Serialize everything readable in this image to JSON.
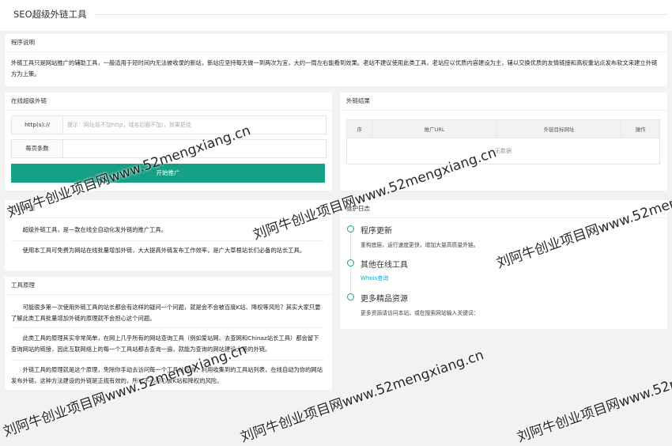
{
  "page": {
    "title": "SEO超级外链工具"
  },
  "intro": {
    "heading": "程序说明",
    "text": "外链工具只是网站推广的辅助工具，一般适用于短时间内无法被收录的新站，新站应坚持每天做一到两次为宜，大约一周左右能看到效果。老站不建议使用此类工具，老站应以优质内容建设为主，辅以交换优质的友情链接和高权重站点发布软文来建立外链方为上策。"
  },
  "online": {
    "heading": "在线超级外链",
    "url_label": "http(s)://",
    "url_placeholder": "提示：网址前不加http，域名后面不加/，效果更佳",
    "perpage_label": "每页条数",
    "submit_label": "开始推广"
  },
  "result": {
    "heading": "外链结果",
    "columns": [
      "序",
      "推广URL",
      "外链目标网址",
      "操作"
    ],
    "empty": "无数据"
  },
  "tool_intro": {
    "heading": "工具介绍",
    "p1": "超级外链工具，是一款在线全自动化发外链的推广工具。",
    "p2": "使用本工具可免费为网站在线批量增加外链，大大提高外链发布工作效率，是广大草根站长们必备的站长工具。"
  },
  "principle": {
    "heading": "工具原理",
    "p1": "可能很多第一次使用外链工具的站长都会有这样的疑问一个问题，就是会不会被百度K站、降权等风险？其实大家只要了解此类工具批量增加外链的原理就不会担心这个问题。",
    "p2": "此类工具的原理其实非常简单，在网上几乎所有的网站查询工具（例如爱站网、去查网和Chinaz站长工具）都会留下查询网站的链接，因此互联网络上的每一个工具站都去查询一遍，就能为查询的网站建设大量的外链。",
    "p3": "外链工具的原理就是这个原理，免除你手动去访问每一个工具站查询，利用收集到的工具站列表，在线自动为你的网站发布外链，这种方法建设的外链是正规有效的，所以不必担心被K站和降权的风险。"
  },
  "log": {
    "heading": "维护日志",
    "items": [
      {
        "title": "程序更新",
        "text": "重构底层，运行速度更快，增加大量高质量外链。"
      },
      {
        "title": "其他在线工具",
        "link": "Whois查询"
      },
      {
        "title": "更多精品资源",
        "text": "更多资源请访问本站，或在搜索网站输入关键词："
      }
    ]
  },
  "watermark": "刘阿牛创业项目网www.52mengxiang.cn",
  "colors": {
    "accent": "#16a085",
    "link": "#01aaed"
  }
}
